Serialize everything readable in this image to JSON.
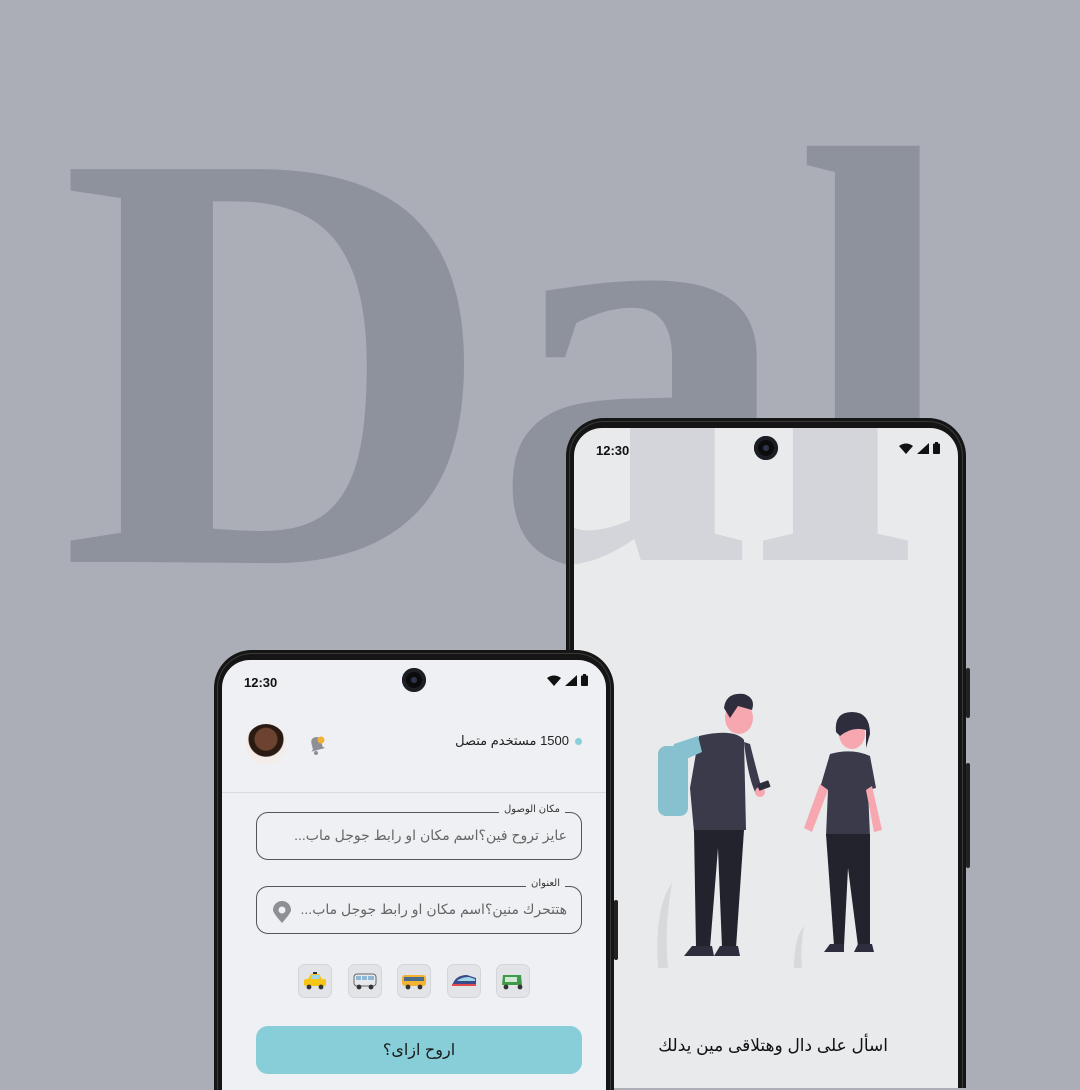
{
  "brand": {
    "wordmark": "Dal"
  },
  "colors": {
    "background": "#abaeb7",
    "wordmark": "#8d929d",
    "accent": "#87ced9",
    "screen": "#e9eaec"
  },
  "onboarding_screen": {
    "status_time": "12:30",
    "illustration": "two-people-talking-illustration",
    "tagline": "اسأل على دال وهتلاقى مين يدلك"
  },
  "search_screen": {
    "status_time": "12:30",
    "online_users": "1500 مستخدم متصل",
    "destination": {
      "label": "مكان الوصول",
      "placeholder": "عايز تروح فين؟اسم مكان او رابط جوجل ماب..."
    },
    "origin": {
      "label": "العنوان",
      "placeholder": "هتتحرك منين؟اسم مكان او رابط جوجل ماب..."
    },
    "transport_modes": [
      "taxi-icon",
      "microbus-icon",
      "bus-icon",
      "train-icon",
      "tuktuk-icon"
    ],
    "cta_label": "اروح ازاى؟"
  }
}
